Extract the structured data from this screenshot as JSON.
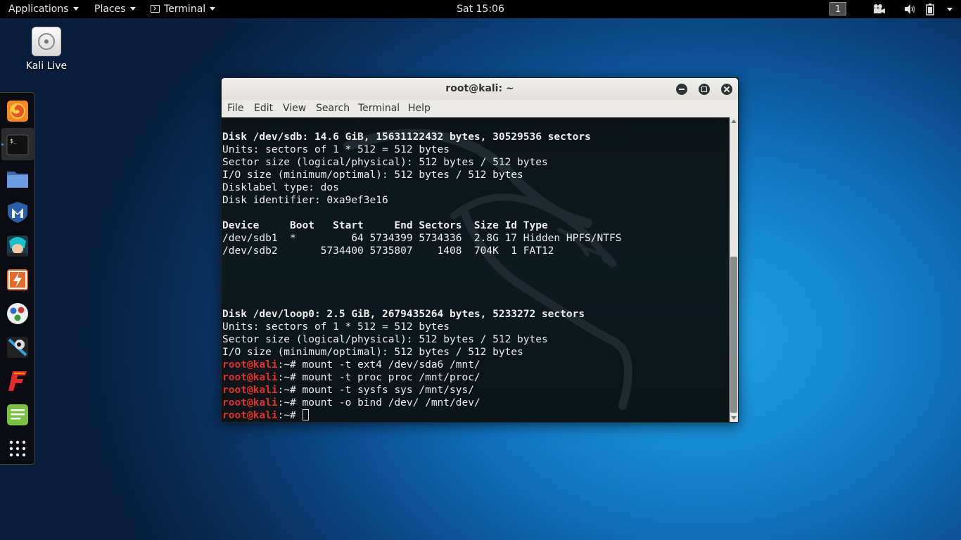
{
  "topbar": {
    "applications": "Applications",
    "places": "Places",
    "terminal": "Terminal",
    "clock": "Sat 15:06",
    "workspace": "1",
    "tray_icons": [
      "video-icon",
      "volume-icon",
      "battery-icon",
      "power-menu-caret"
    ]
  },
  "desktop": {
    "icons": [
      {
        "label": "Kali Live",
        "icon": "drive-icon"
      }
    ]
  },
  "dock": {
    "items": [
      "firefox-icon",
      "terminal-icon",
      "files-icon",
      "metasploit-icon",
      "armitage-icon",
      "burpsuite-icon",
      "maltego-icon",
      "beef-icon",
      "faraday-icon",
      "leafpad-icon",
      "show-apps-icon"
    ],
    "active": "terminal-icon"
  },
  "terminal_window": {
    "title": "root@kali: ~",
    "menu": [
      "File",
      "Edit",
      "View",
      "Search",
      "Terminal",
      "Help"
    ],
    "lines": [
      {
        "t": "Disk /dev/sdb: 14.6 GiB, 15631122432 bytes, 30529536 sectors",
        "bold": true
      },
      {
        "t": "Units: sectors of 1 * 512 = 512 bytes"
      },
      {
        "t": "Sector size (logical/physical): 512 bytes / 512 bytes"
      },
      {
        "t": "I/O size (minimum/optimal): 512 bytes / 512 bytes"
      },
      {
        "t": "Disklabel type: dos"
      },
      {
        "t": "Disk identifier: 0xa9ef3e16"
      },
      {
        "t": ""
      },
      {
        "t": "Device     Boot   Start     End Sectors  Size Id Type",
        "bold": true
      },
      {
        "t": "/dev/sdb1  *         64 5734399 5734336  2.8G 17 Hidden HPFS/NTFS"
      },
      {
        "t": "/dev/sdb2       5734400 5735807    1408  704K  1 FAT12"
      },
      {
        "t": ""
      },
      {
        "t": ""
      },
      {
        "t": ""
      },
      {
        "t": ""
      },
      {
        "t": "Disk /dev/loop0: 2.5 GiB, 2679435264 bytes, 5233272 sectors",
        "bold": true
      },
      {
        "t": "Units: sectors of 1 * 512 = 512 bytes"
      },
      {
        "t": "Sector size (logical/physical): 512 bytes / 512 bytes"
      },
      {
        "t": "I/O size (minimum/optimal): 512 bytes / 512 bytes"
      },
      {
        "prompt": "root@kali",
        "suffix": ":~# ",
        "t": "mount -t ext4 /dev/sda6 /mnt/"
      },
      {
        "prompt": "root@kali",
        "suffix": ":~# ",
        "t": "mount -t proc proc /mnt/proc/"
      },
      {
        "prompt": "root@kali",
        "suffix": ":~# ",
        "t": "mount -t sysfs sys /mnt/sys/"
      },
      {
        "prompt": "root@kali",
        "suffix": ":~# ",
        "t": "mount -o bind /dev/ /mnt/dev/"
      },
      {
        "prompt": "root@kali",
        "suffix": ":~# ",
        "t": "",
        "cursor": true
      }
    ]
  },
  "colors": {
    "prompt": "#e0312b",
    "terminal_bg": "#0c1012",
    "topbar_bg": "#000000"
  }
}
